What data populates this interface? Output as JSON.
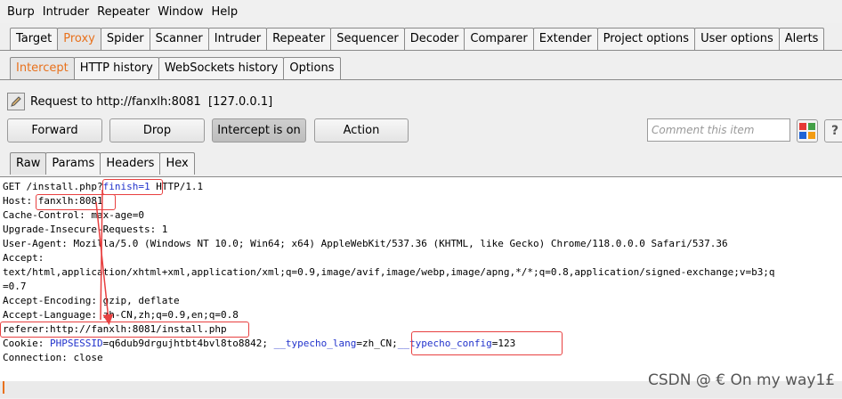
{
  "menubar": [
    "Burp",
    "Intruder",
    "Repeater",
    "Window",
    "Help"
  ],
  "main_tabs": [
    "Target",
    "Proxy",
    "Spider",
    "Scanner",
    "Intruder",
    "Repeater",
    "Sequencer",
    "Decoder",
    "Comparer",
    "Extender",
    "Project options",
    "User options",
    "Alerts"
  ],
  "proxy_tabs": [
    "Intercept",
    "HTTP history",
    "WebSockets history",
    "Options"
  ],
  "request_label": "Request to http://fanxlh:8081  [127.0.0.1]",
  "buttons": {
    "forward": "Forward",
    "drop": "Drop",
    "intercept": "Intercept is on",
    "action": "Action"
  },
  "comment_placeholder": "Comment this item",
  "help_label": "?",
  "view_tabs": [
    "Raw",
    "Params",
    "Headers",
    "Hex"
  ],
  "request": {
    "l1_a": "GET /install.php?",
    "l1_b": "finish=1",
    "l1_c": " HTTP/1.1",
    "l2_a": "Host: ",
    "l2_b": "fanxlh:8081",
    "l3": "Cache-Control: max-age=0",
    "l4": "Upgrade-Insecure-Requests: 1",
    "l5": "User-Agent: Mozilla/5.0 (Windows NT 10.0; Win64; x64) AppleWebKit/537.36 (KHTML, like Gecko) Chrome/118.0.0.0 Safari/537.36",
    "l6": "Accept:",
    "l7": "text/html,application/xhtml+xml,application/xml;q=0.9,image/avif,image/webp,image/apng,*/*;q=0.8,application/signed-exchange;v=b3;q",
    "l8": "=0.7",
    "l9": "Accept-Encoding: gzip, deflate",
    "l10": "Accept-Language: zh-CN,zh;q=0.9,en;q=0.8",
    "l11": "referer:http://fanxlh:8081/install.php",
    "l12_a": "Cookie: ",
    "l12_b": "PHPSESSID",
    "l12_c": "=q6dub9drgujhtbt4bvl8to8842; ",
    "l12_d": "__typecho_lang",
    "l12_e": "=zh_CN",
    "l12_f": ";",
    "l12_g": "__typecho_config",
    "l12_h": "=123",
    "l13": "Connection: close"
  },
  "watermark": "CSDN @ € On my way1£",
  "colors": {
    "accent": "#e8711c",
    "highlight": "#e84040",
    "param": "#2233cc"
  }
}
